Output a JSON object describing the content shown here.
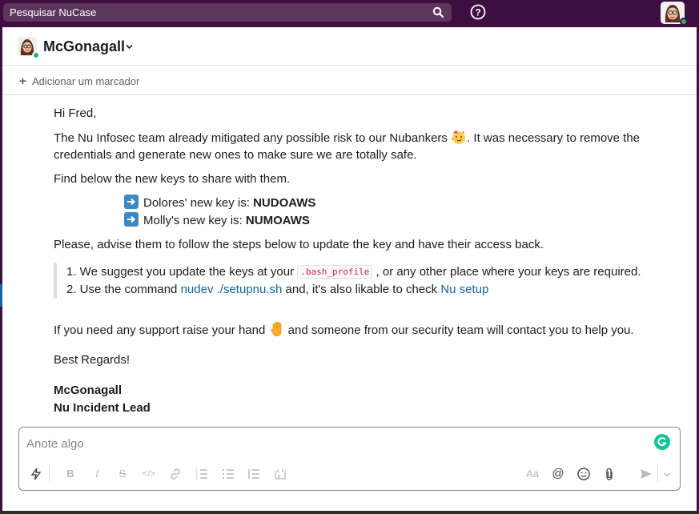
{
  "search": {
    "placeholder": "Pesquisar NuCase"
  },
  "channel": {
    "name": "McGonagall"
  },
  "bookmark": {
    "label": "Adicionar um marcador"
  },
  "message": {
    "greeting": "Hi Fred,",
    "para1_a": "The Nu Infosec team already mitigated any possible risk to our Nubankers",
    "para1_b": ". It was necessary to remove the",
    "para1_c": "credentials and generate new ones to make sure we are totally safe.",
    "find_below": "Find below the new keys to share with them.",
    "key1_label": "Dolores' new key is: ",
    "key1_value": "NUDOAWS",
    "key2_label": "Molly's new key is: ",
    "key2_value": "NUMOAWS",
    "advise": "Please, advise them to follow the steps below to update the key and have their access back.",
    "step1_a": "1. We suggest you update the keys at your ",
    "step1_code": ".bash_profile",
    "step1_b": " , or any other place where your keys are required.",
    "step2_a": "2. Use the command ",
    "step2_link1": "nudev ./setupnu.sh",
    "step2_b": " and, it's also likable to check ",
    "step2_link2": "Nu setup",
    "support_a": "If you need any support raise your hand ",
    "support_b": " and someone from our security team will contact you to help you.",
    "regards": "Best Regards!",
    "signature_name": "McGonagall",
    "signature_title": "Nu Incident Lead"
  },
  "composer": {
    "placeholder": "Anote algo",
    "format_icons": [
      "lightning-icon",
      "bold-icon",
      "italic-icon",
      "strike-icon",
      "code-icon",
      "link-icon",
      "ordered-list-icon",
      "bullet-list-icon",
      "blockquote-icon",
      "code-block-icon"
    ],
    "right_icons": [
      "text-format-icon",
      "mention-icon",
      "emoji-icon",
      "attach-icon",
      "send-icon",
      "send-options-icon"
    ]
  },
  "colors": {
    "sidebar_bg": "#3f0e40",
    "link": "#1264a3",
    "code": "#e01e5a",
    "presence": "#2bac76"
  }
}
